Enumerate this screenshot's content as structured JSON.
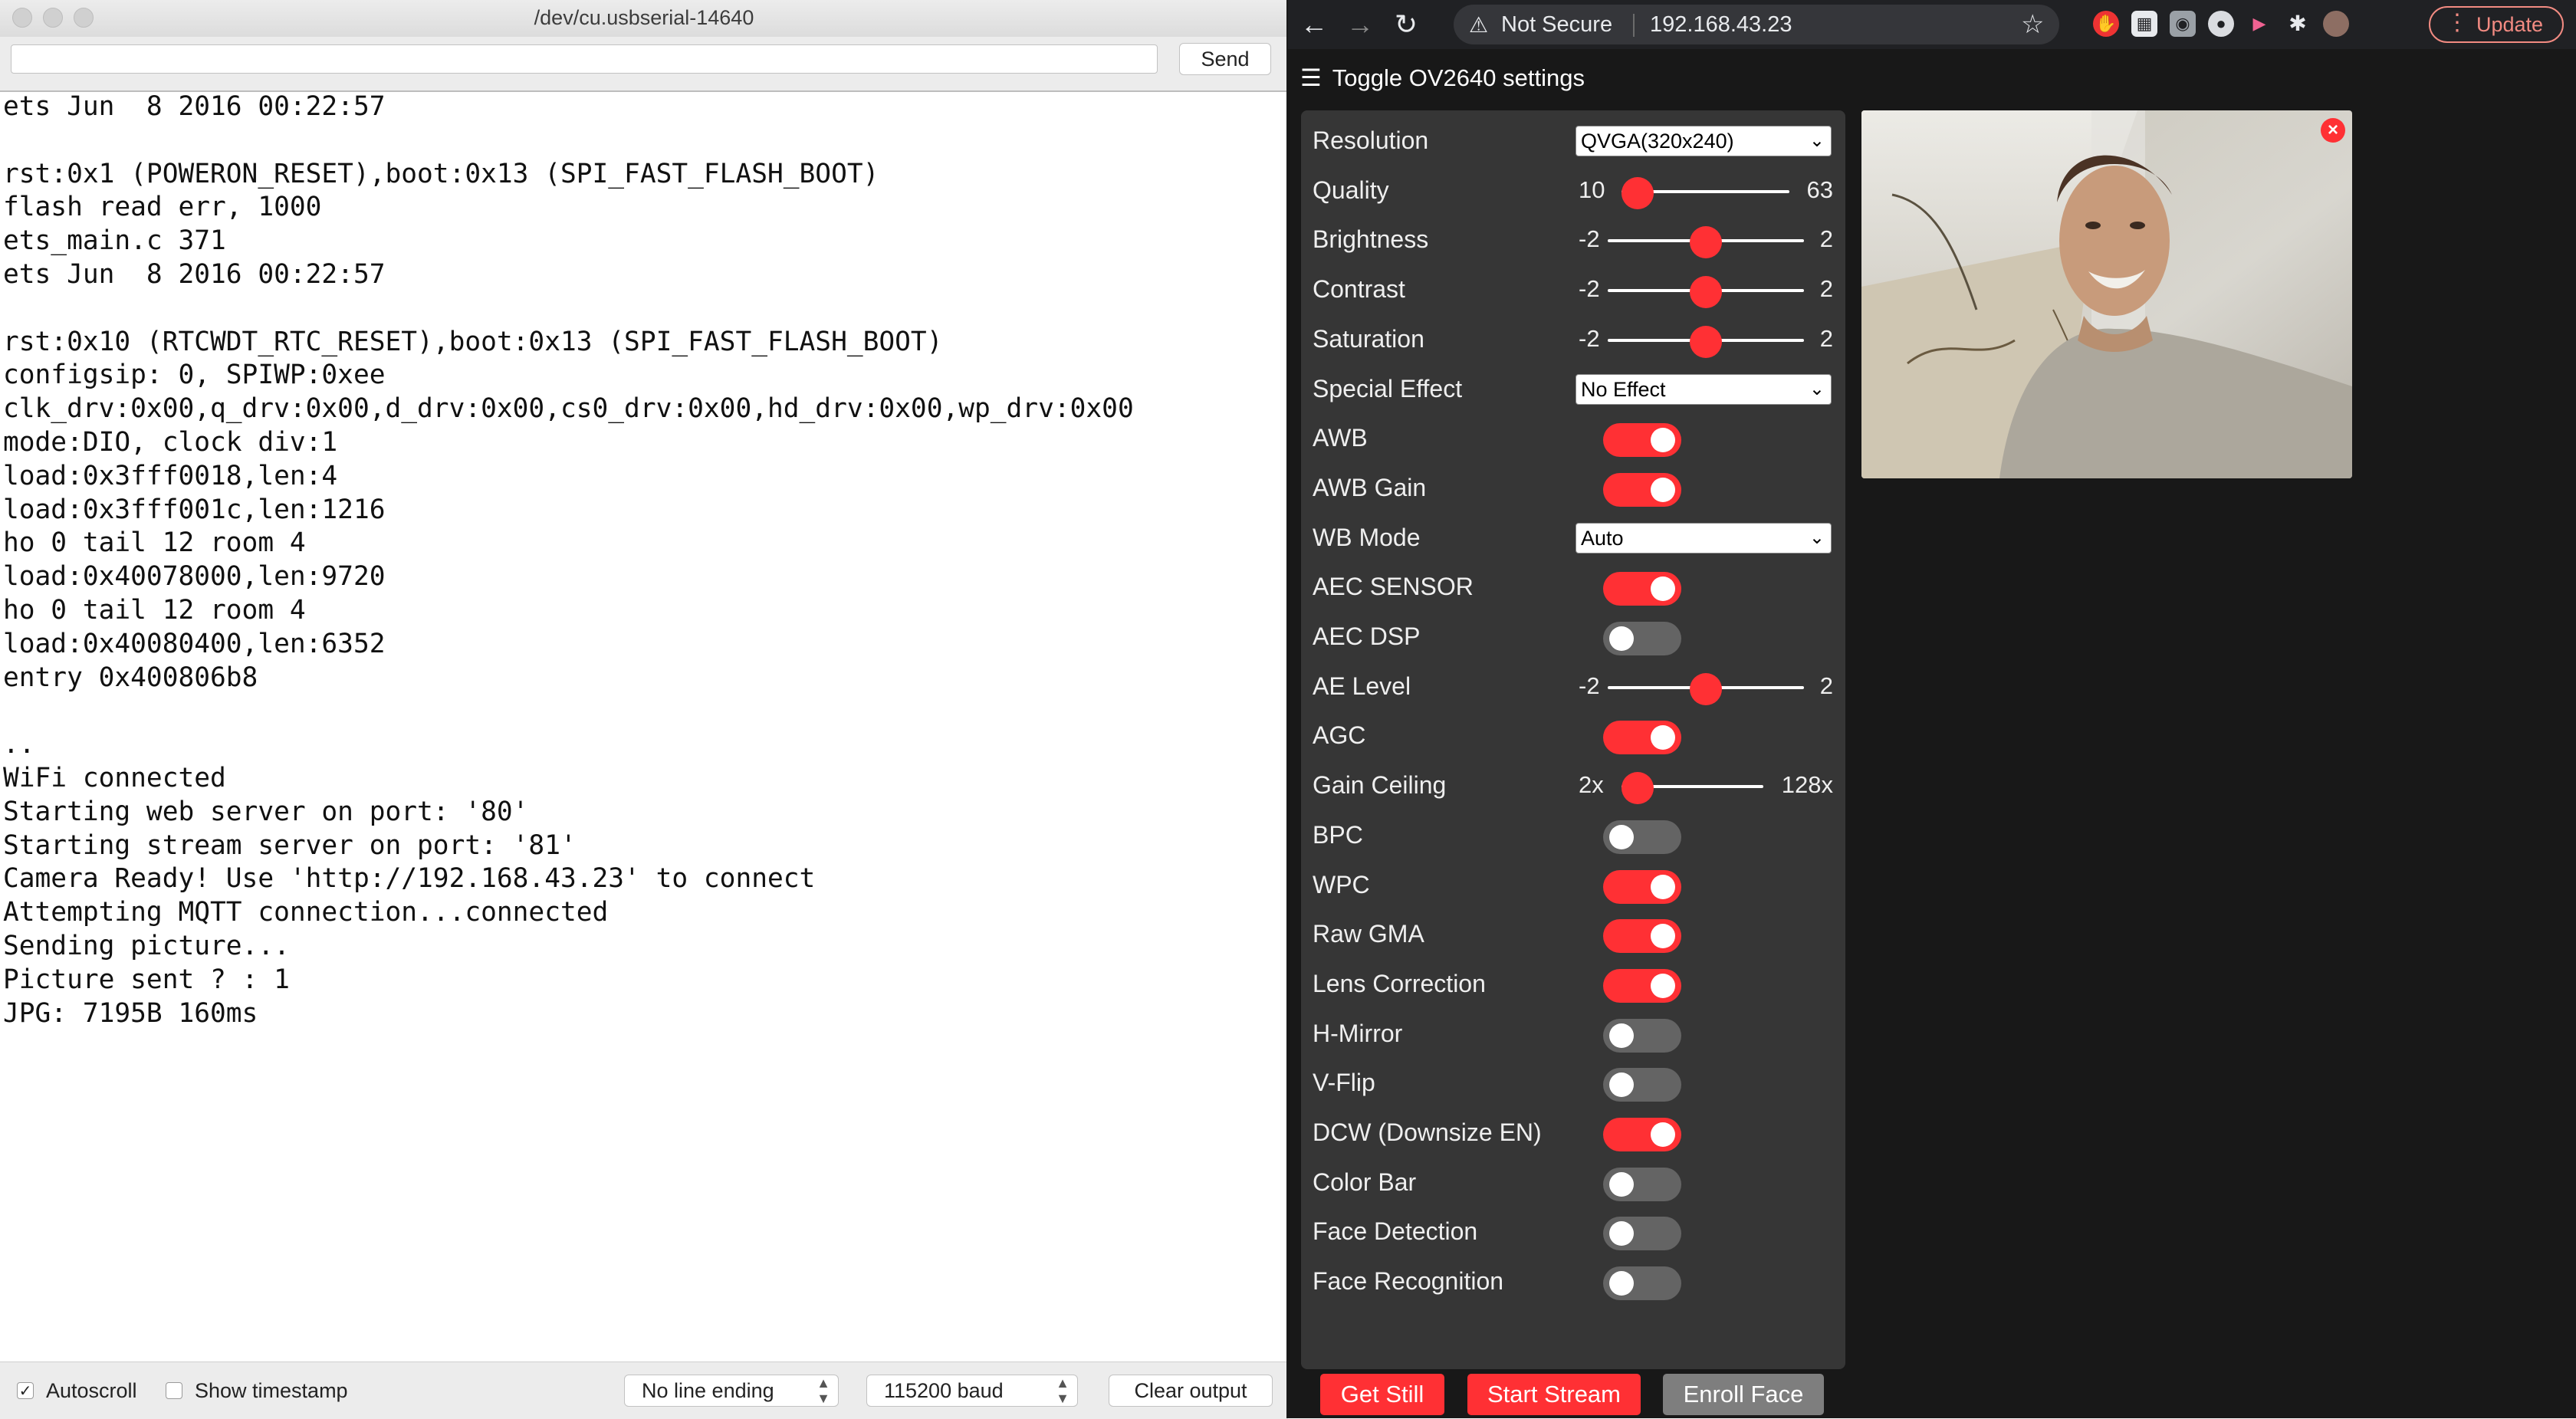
{
  "serial": {
    "window_title": "/dev/cu.usbserial-14640",
    "send_label": "Send",
    "send_value": "",
    "lines": [
      "ets Jun  8 2016 00:22:57",
      "",
      "rst:0x1 (POWERON_RESET),boot:0x13 (SPI_FAST_FLASH_BOOT)",
      "flash read err, 1000",
      "ets_main.c 371",
      "ets Jun  8 2016 00:22:57",
      "",
      "rst:0x10 (RTCWDT_RTC_RESET),boot:0x13 (SPI_FAST_FLASH_BOOT)",
      "configsip: 0, SPIWP:0xee",
      "clk_drv:0x00,q_drv:0x00,d_drv:0x00,cs0_drv:0x00,hd_drv:0x00,wp_drv:0x00",
      "mode:DIO, clock div:1",
      "load:0x3fff0018,len:4",
      "load:0x3fff001c,len:1216",
      "ho 0 tail 12 room 4",
      "load:0x40078000,len:9720",
      "ho 0 tail 12 room 4",
      "load:0x40080400,len:6352",
      "entry 0x400806b8",
      "",
      "..",
      "WiFi connected",
      "Starting web server on port: '80'",
      "Starting stream server on port: '81'",
      "Camera Ready! Use 'http://192.168.43.23' to connect",
      "Attempting MQTT connection...connected",
      "Sending picture...",
      "Picture sent ? : 1",
      "JPG: 7195B 160ms"
    ],
    "autoscroll_label": "Autoscroll",
    "autoscroll_checked": true,
    "timestamp_label": "Show timestamp",
    "timestamp_checked": false,
    "line_ending": "No line ending",
    "baud": "115200 baud",
    "clear_label": "Clear output"
  },
  "browser": {
    "security_label": "Not Secure",
    "url": "192.168.43.23",
    "update_label": "Update",
    "menu_title": "Toggle OV2640 settings",
    "controls": [
      {
        "kind": "select",
        "label": "Resolution",
        "value": "QVGA(320x240)"
      },
      {
        "kind": "range",
        "label": "Quality",
        "min": "10",
        "max": "63",
        "value": 10,
        "lo": 10,
        "hi": 63
      },
      {
        "kind": "range",
        "label": "Brightness",
        "min": "-2",
        "max": "2",
        "value": 0,
        "lo": -2,
        "hi": 2
      },
      {
        "kind": "range",
        "label": "Contrast",
        "min": "-2",
        "max": "2",
        "value": 0,
        "lo": -2,
        "hi": 2
      },
      {
        "kind": "range",
        "label": "Saturation",
        "min": "-2",
        "max": "2",
        "value": 0,
        "lo": -2,
        "hi": 2
      },
      {
        "kind": "select",
        "label": "Special Effect",
        "value": "No Effect"
      },
      {
        "kind": "toggle",
        "label": "AWB",
        "on": true
      },
      {
        "kind": "toggle",
        "label": "AWB Gain",
        "on": true
      },
      {
        "kind": "select",
        "label": "WB Mode",
        "value": "Auto"
      },
      {
        "kind": "toggle",
        "label": "AEC SENSOR",
        "on": true
      },
      {
        "kind": "toggle",
        "label": "AEC DSP",
        "on": false
      },
      {
        "kind": "range",
        "label": "AE Level",
        "min": "-2",
        "max": "2",
        "value": 0,
        "lo": -2,
        "hi": 2
      },
      {
        "kind": "toggle",
        "label": "AGC",
        "on": true
      },
      {
        "kind": "range",
        "label": "Gain Ceiling",
        "min": "2x",
        "max": "128x",
        "value": 0,
        "lo": 0,
        "hi": 6,
        "wide": true
      },
      {
        "kind": "toggle",
        "label": "BPC",
        "on": false
      },
      {
        "kind": "toggle",
        "label": "WPC",
        "on": true
      },
      {
        "kind": "toggle",
        "label": "Raw GMA",
        "on": true
      },
      {
        "kind": "toggle",
        "label": "Lens Correction",
        "on": true
      },
      {
        "kind": "toggle",
        "label": "H-Mirror",
        "on": false
      },
      {
        "kind": "toggle",
        "label": "V-Flip",
        "on": false
      },
      {
        "kind": "toggle",
        "label": "DCW (Downsize EN)",
        "on": true
      },
      {
        "kind": "toggle",
        "label": "Color Bar",
        "on": false
      },
      {
        "kind": "toggle",
        "label": "Face Detection",
        "on": false
      },
      {
        "kind": "toggle",
        "label": "Face Recognition",
        "on": false
      }
    ],
    "buttons": {
      "get_still": "Get Still",
      "start_stream": "Start Stream",
      "enroll_face": "Enroll Face"
    },
    "colors": {
      "accent": "#ff3034",
      "panel": "#363636",
      "page_bg": "#181818",
      "disabled_button": "#7e7e7e"
    }
  }
}
